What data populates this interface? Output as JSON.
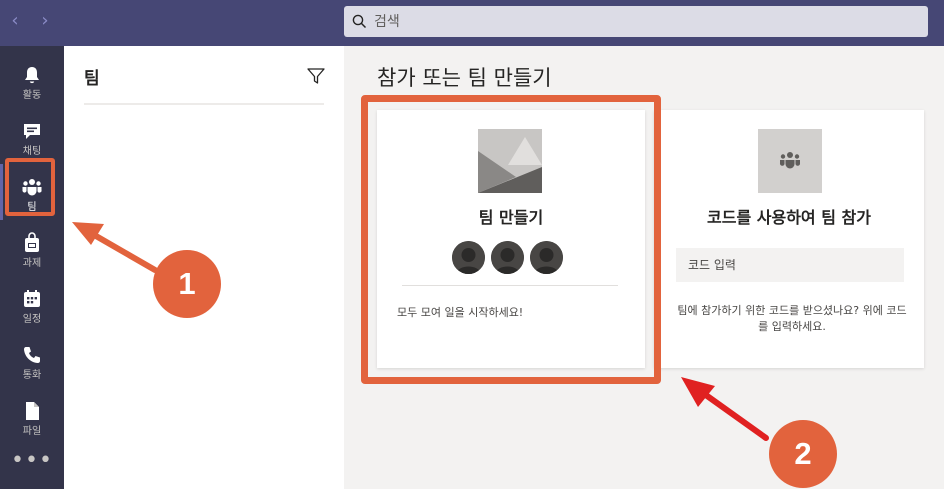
{
  "titlebar": {
    "back_icon": "chevron-left-icon",
    "forward_icon": "chevron-right-icon",
    "search_placeholder": "검색"
  },
  "rail": {
    "items": [
      {
        "label": "활동",
        "icon": "bell-icon"
      },
      {
        "label": "채팅",
        "icon": "chat-icon"
      },
      {
        "label": "팀",
        "icon": "teams-icon",
        "active": true
      },
      {
        "label": "과제",
        "icon": "backpack-icon"
      },
      {
        "label": "일정",
        "icon": "calendar-icon"
      },
      {
        "label": "통화",
        "icon": "phone-icon"
      },
      {
        "label": "파일",
        "icon": "file-icon"
      }
    ],
    "more_label": "•••"
  },
  "teams_pane": {
    "title": "팀",
    "filter_icon": "filter-icon"
  },
  "main": {
    "title": "참가 또는 팀 만들기",
    "create_card": {
      "title": "팀 만들기",
      "description": "모두 모여 일을 시작하세요!"
    },
    "join_card": {
      "title": "코드를 사용하여 팀 참가",
      "code_placeholder": "코드 입력",
      "description": "팀에 참가하기 위한 코드를 받으셨나요? 위에 코드를 입력하세요."
    }
  },
  "annotations": {
    "badge_1": "1",
    "badge_2": "2",
    "color": "#e2633d"
  },
  "colors": {
    "titlebar": "#464775",
    "rail": "#33344a",
    "accent": "#6264a7"
  }
}
